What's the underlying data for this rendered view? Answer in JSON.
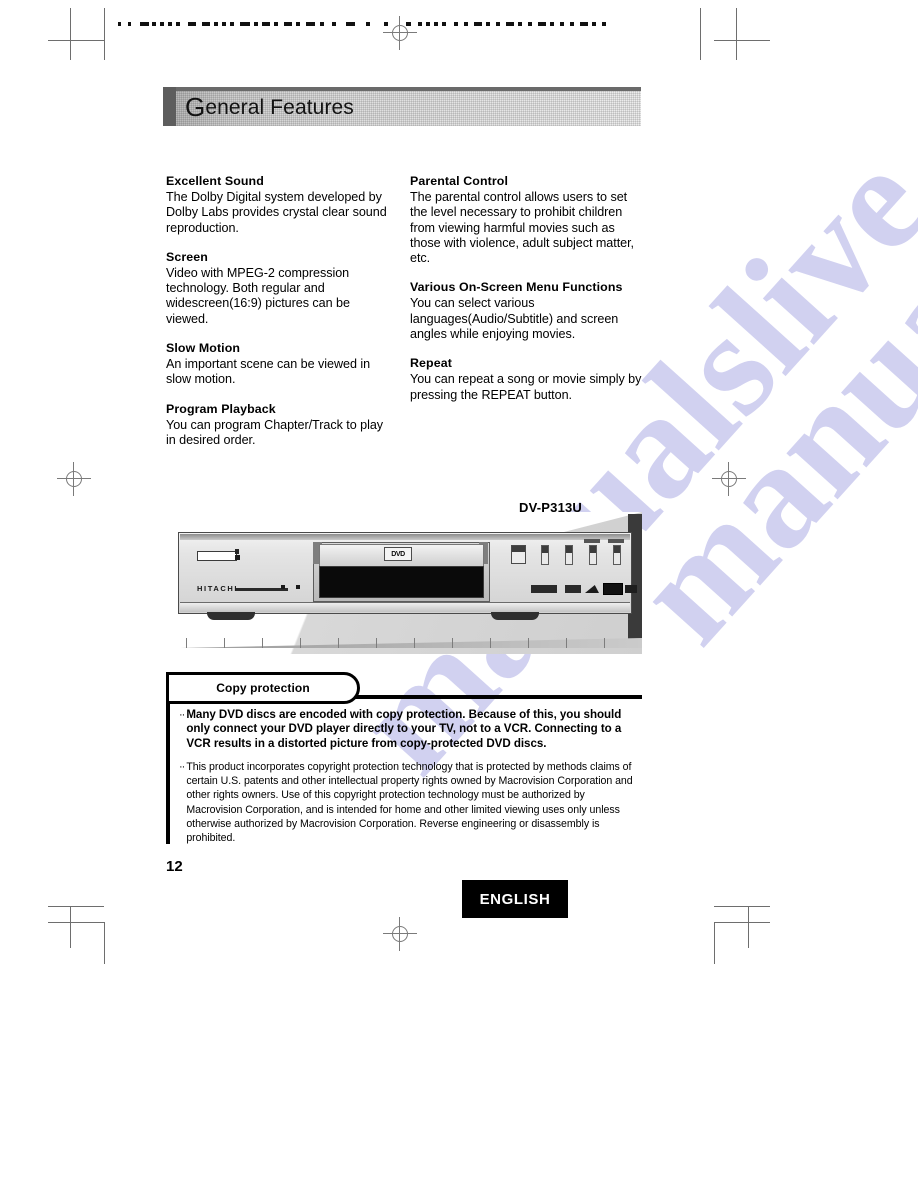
{
  "page": {
    "section_title": "General Features",
    "section_title_initial": "G",
    "section_title_rest": "eneral Features",
    "page_number": "12",
    "language_label": "ENGLISH",
    "watermark_text": "manualslive.com"
  },
  "features": {
    "left_column": [
      {
        "heading": "Excellent Sound",
        "body": "The Dolby Digital system developed by Dolby Labs provides crystal clear sound reproduction."
      },
      {
        "heading": "Screen",
        "body": "Video with MPEG-2 compression technology. Both regular and widescreen(16:9) pictures can be viewed."
      },
      {
        "heading": "Slow Motion",
        "body": "An important scene can be viewed in slow motion."
      },
      {
        "heading": "Program Playback",
        "body": "You can program Chapter/Track to play in desired order."
      }
    ],
    "right_column": [
      {
        "heading": "Parental Control",
        "body": "The parental control allows users to set the level necessary to prohibit children from viewing harmful movies such as those with violence, adult subject matter, etc."
      },
      {
        "heading": "Various On-Screen Menu Functions",
        "body": "You can select various languages(Audio/Subtitle) and screen angles while enjoying movies."
      },
      {
        "heading": "Repeat",
        "body": "You can repeat a song or movie simply by pressing the REPEAT button."
      }
    ]
  },
  "product": {
    "model_number": "DV-P313U",
    "brand": "HITACHI",
    "disc_logo": "DVD"
  },
  "copy_protection": {
    "tab_label": "Copy protection",
    "bullet_marker": "··",
    "notes": [
      {
        "emphasis": "bold",
        "text": "Many DVD discs are encoded with copy protection. Because of this, you should only connect your DVD player directly to your TV, not to a VCR. Connecting to a VCR results in a distorted picture from copy-protected DVD discs."
      },
      {
        "emphasis": "normal",
        "text": "This product incorporates copyright protection technology that is protected by methods claims of certain U.S. patents and other intellectual property rights owned by Macrovision Corporation and other rights owners. Use of this copyright protection technology must be authorized by Macrovision Corporation, and is intended for home and other limited viewing uses only unless otherwise authorized by Macrovision Corporation. Reverse engineering or disassembly is prohibited."
      }
    ]
  }
}
